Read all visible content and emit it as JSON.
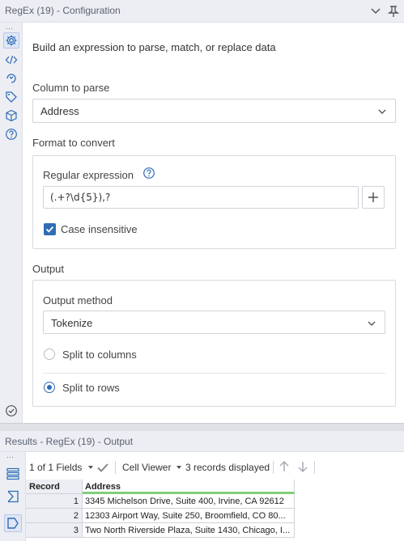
{
  "config": {
    "title": "RegEx (19) - Configuration",
    "intro": "Build an expression to parse, match, or replace data",
    "column_to_parse": {
      "label": "Column to parse",
      "value": "Address"
    },
    "format_to_convert": {
      "label": "Format to convert",
      "regex_label": "Regular expression",
      "regex_value": "(.+?\\d{5}),?",
      "case_insensitive_label": "Case insensitive",
      "case_insensitive_checked": true
    },
    "output": {
      "label": "Output",
      "method_label": "Output method",
      "method_value": "Tokenize",
      "options": [
        {
          "label": "Split to columns",
          "selected": false
        },
        {
          "label": "Split to rows",
          "selected": true
        }
      ]
    },
    "sidebar_icons": [
      "gear-icon",
      "code-icon",
      "circle-arrow-icon",
      "tag-icon",
      "cube-icon",
      "help-icon",
      "check-circle-icon"
    ]
  },
  "results": {
    "title": "Results - RegEx (19) - Output",
    "fields_selector": "1 of 1 Fields",
    "cell_viewer": "Cell Viewer",
    "records_displayed": "3 records displayed",
    "columns": [
      "Record",
      "Address"
    ],
    "rows": [
      {
        "record": "1",
        "address": "3345 Michelson Drive, Suite 400, Irvine, CA 92612"
      },
      {
        "record": "2",
        "address": "12303 Airport Way, Suite 250, Broomfield, CO 80..."
      },
      {
        "record": "3",
        "address": "Two North Riverside Plaza, Suite 1430, Chicago, I..."
      }
    ]
  },
  "colors": {
    "accent": "#2f6db5",
    "panel_bg": "#eceef3",
    "header_underline": "#7ed07a"
  }
}
